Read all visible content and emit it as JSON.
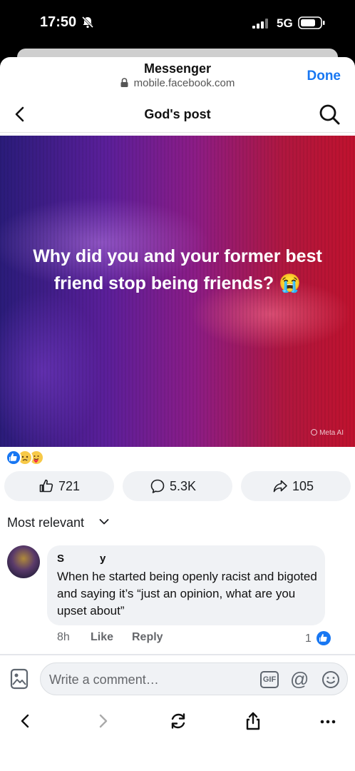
{
  "status_bar": {
    "time": "17:50",
    "network": "5G"
  },
  "browser": {
    "app_title": "Messenger",
    "url": "mobile.facebook.com",
    "done_label": "Done"
  },
  "nav": {
    "title": "God's post"
  },
  "post": {
    "text": "Why did you and your former best friend stop being friends? 😭",
    "badge": "Meta AI"
  },
  "reactions": [
    "like-icon",
    "sad-icon",
    "care-icon"
  ],
  "stats": {
    "likes": "721",
    "comments": "5.3K",
    "shares": "105"
  },
  "comments": {
    "sort_label": "Most relevant",
    "items": [
      {
        "author": "S            y",
        "text": "When he started being openly racist and bigoted and saying it’s “just an opinion, what are you upset about”",
        "time": "8h",
        "like_label": "Like",
        "reply_label": "Reply",
        "reaction_count": "1"
      }
    ]
  },
  "composer": {
    "placeholder": "Write a comment…",
    "gif_label": "GIF",
    "at_label": "@"
  },
  "colors": {
    "accent": "#1877f2",
    "pill_bg": "#f0f2f5",
    "text_secondary": "#65676b"
  }
}
